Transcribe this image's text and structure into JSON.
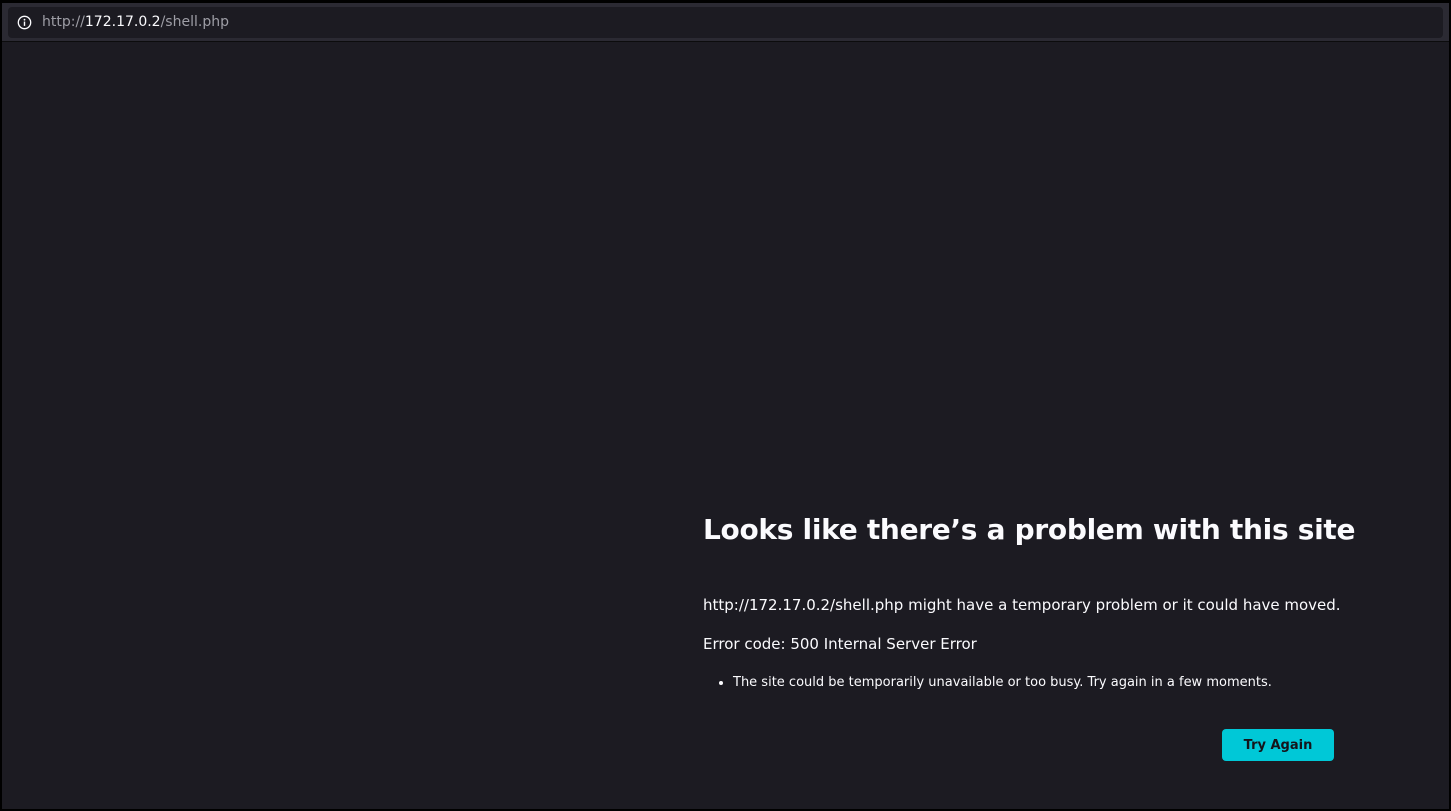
{
  "browser": {
    "url_scheme": "http://",
    "url_host": "172.17.0.2",
    "url_path": "/shell.php",
    "site_info_icon": "info-circle-icon"
  },
  "error_page": {
    "title": "Looks like there’s a problem with this site",
    "description": "http://172.17.0.2/shell.php might have a temporary problem or it could have moved.",
    "error_code": "Error code: 500 Internal Server Error",
    "suggestions": [
      "The site could be temporarily unavailable or too busy. Try again in a few moments."
    ],
    "try_again_label": "Try Again"
  },
  "colors": {
    "page_background": "#1c1b22",
    "toolbar_background": "#2b2a33",
    "accent_button": "#00c8d7",
    "text_primary": "#fbfbfe",
    "text_muted": "#9e9ea6"
  }
}
